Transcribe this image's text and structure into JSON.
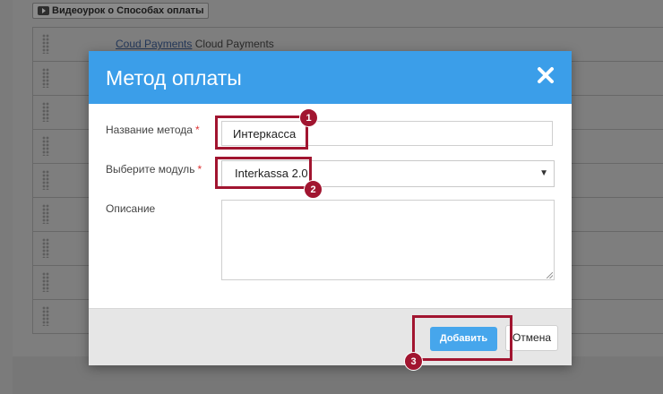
{
  "background": {
    "video_button_label": "Видеоурок о Способах оплаты",
    "rows": [
      {
        "link": "Coud Payments",
        "text": "Cloud Payments"
      },
      {
        "link": "",
        "text": ""
      },
      {
        "link": "",
        "text": ""
      },
      {
        "link": "",
        "text": ""
      },
      {
        "link": "",
        "text": ""
      },
      {
        "link": "",
        "text": ""
      },
      {
        "link": "",
        "text": ""
      },
      {
        "link": "",
        "text": ""
      },
      {
        "link": "",
        "text": ""
      }
    ]
  },
  "modal": {
    "title": "Метод оплаты",
    "fields": {
      "name_label": "Название метода",
      "name_required": "*",
      "name_value": "Интеркасса",
      "module_label": "Выберите модуль",
      "module_required": "*",
      "module_value": "Interkassa 2.0",
      "description_label": "Описание",
      "description_value": ""
    },
    "buttons": {
      "add_label": "Добавить",
      "cancel_label": "Отмена"
    }
  },
  "annotations": {
    "badge_1": "1",
    "badge_2": "2",
    "badge_3": "3",
    "color": "#a11530"
  },
  "colors": {
    "header": "#3b9ee9",
    "primary_button": "#46a6ec",
    "required": "#dd3333"
  },
  "icons": {
    "close": "close-icon",
    "video": "youtube-icon",
    "select": "caret-down-icon",
    "drag": "drag-handle-icon"
  }
}
